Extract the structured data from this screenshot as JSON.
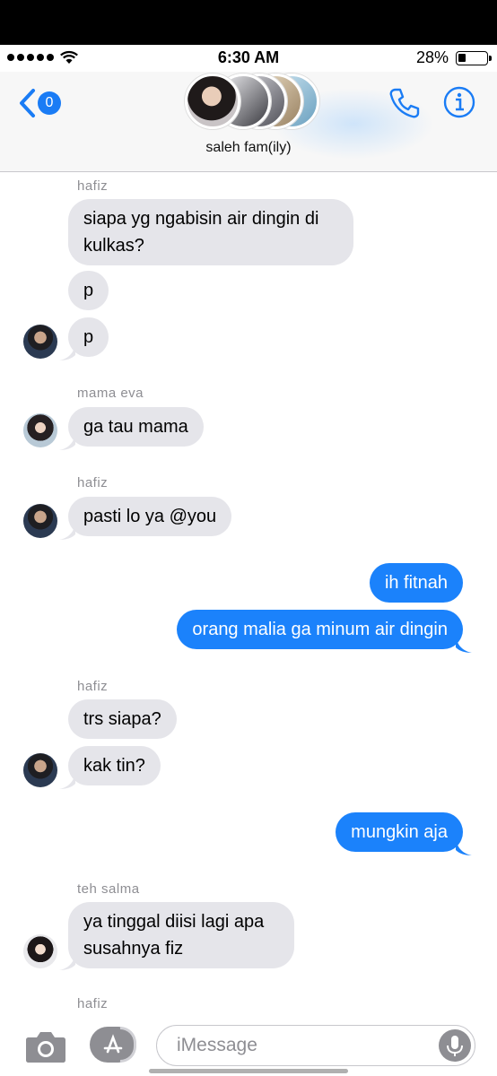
{
  "status": {
    "time": "6:30 AM",
    "battery_percent": "28%",
    "battery_level": 0.28
  },
  "header": {
    "back_count": "0",
    "group_name": "saleh fam(ily)",
    "icons": [
      "back-chevron-icon",
      "phone-icon",
      "info-icon"
    ]
  },
  "messages": [
    {
      "sender": "hafiz"
    },
    {
      "text": "siapa yg ngabisin air dingin di kulkas?",
      "line1": "siapa yg ngabisin air dingin di",
      "line2": "kulkas?"
    },
    {
      "text": "p"
    },
    {
      "text": "p"
    },
    {
      "sender": "mama eva"
    },
    {
      "text": "ga tau mama"
    },
    {
      "sender": "hafiz"
    },
    {
      "text": "pasti lo ya @you"
    },
    {
      "text": "ih fitnah"
    },
    {
      "text": "orang malia ga minum air dingin"
    },
    {
      "sender": "hafiz"
    },
    {
      "text": "trs siapa?"
    },
    {
      "text": "kak tin?"
    },
    {
      "text": "mungkin aja"
    },
    {
      "sender": "teh salma"
    },
    {
      "text": "ya tinggal diisi lagi apa susahnya fiz",
      "line1": "ya tinggal diisi lagi apa",
      "line2": "susahnya fiz"
    },
    {
      "sender": "hafiz"
    }
  ],
  "composer": {
    "placeholder": "iMessage",
    "icons": [
      "camera-icon",
      "app-store-icon",
      "microphone-icon"
    ]
  },
  "colors": {
    "outgoing": "#1b82fb",
    "incoming": "#e5e5ea",
    "accent": "#1a7cf5"
  }
}
